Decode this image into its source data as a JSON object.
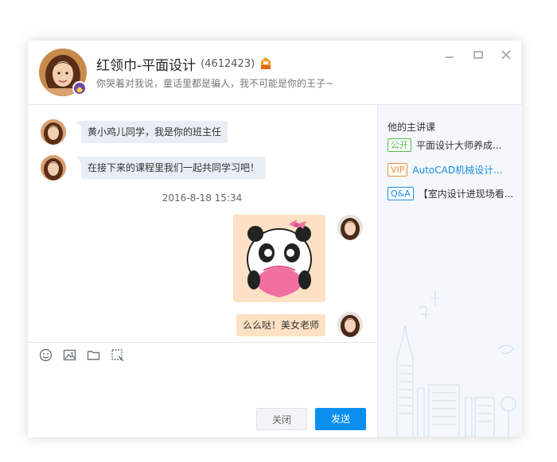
{
  "header": {
    "name": "红领巾-平面设计",
    "uid": "(4612423)",
    "signature": "你哭着对我说，童话里都是骗人，我不可能是你的王子~"
  },
  "chat": {
    "messages_left": [
      {
        "text": "黄小鸡儿同学，我是你的班主任"
      },
      {
        "text": "在接下来的课程里我们一起共同学习吧！"
      }
    ],
    "timestamp": "2016-8-18 15:34",
    "message_right": {
      "text": "么么哒！美女老师"
    }
  },
  "toolbar": {
    "close_label": "关闭",
    "send_label": "发送"
  },
  "sidebar": {
    "title": "他的主讲课",
    "courses": [
      {
        "tag": "公开",
        "name": "平面设计大师养成...",
        "tag_color": "#52b84a",
        "name_color": "#333333"
      },
      {
        "tag": "VIP",
        "name": "AutoCAD机械设计...",
        "tag_color": "#f08c3a",
        "name_color": "#1a8be8"
      },
      {
        "tag": "Q&A",
        "name": "【室内设计进现场看...",
        "tag_color": "#1a8be8",
        "name_color": "#333333"
      }
    ]
  },
  "colors": {
    "accent": "#0a8ff0",
    "bubble_left": "#e8eef5",
    "bubble_right": "#fde1c4"
  }
}
